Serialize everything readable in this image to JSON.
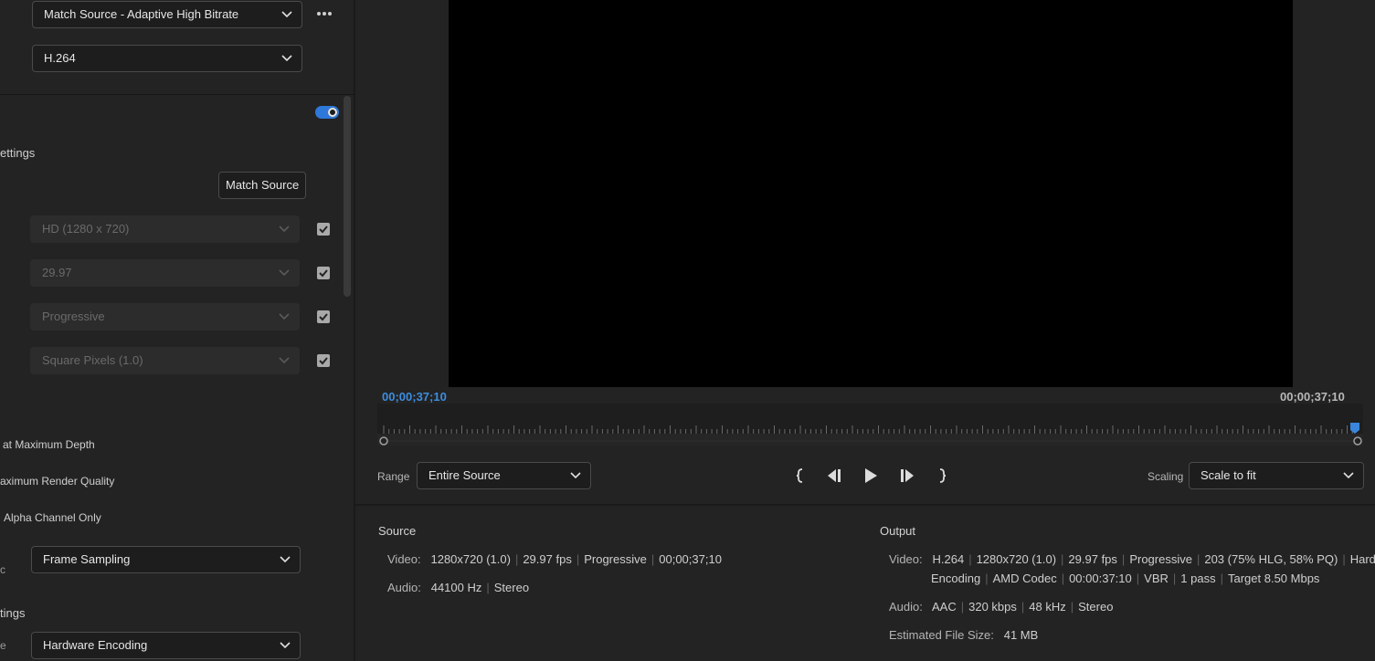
{
  "left": {
    "preset_select": "Match Source - Adaptive High Bitrate",
    "format_select": "H.264",
    "settings_label": "ettings",
    "match_source_button": "Match Source",
    "frame_size_select": "HD (1280 x 720)",
    "frame_rate_select": "29.97",
    "field_order_select": "Progressive",
    "aspect_select": "Square Pixels (1.0)",
    "max_depth_label": "at Maximum Depth",
    "max_render_label": "aximum Render Quality",
    "alpha_label": "Alpha Channel Only",
    "time_interp_label": "c",
    "time_interp_select": "Frame Sampling",
    "encoding_settings_label": "tings",
    "perf_label": "e",
    "performance_select": "Hardware Encoding"
  },
  "player": {
    "timecode_current": "00;00;37;10",
    "timecode_end": "00;00;37;10",
    "range_label": "Range",
    "range_select": "Entire Source",
    "scaling_label": "Scaling",
    "scaling_select": "Scale to fit"
  },
  "source": {
    "heading": "Source",
    "video_key": "Video:",
    "video_values": [
      "1280x720 (1.0)",
      "29.97 fps",
      "Progressive",
      "00;00;37;10"
    ],
    "audio_key": "Audio:",
    "audio_values": [
      "44100 Hz",
      "Stereo"
    ]
  },
  "output": {
    "heading": "Output",
    "video_key": "Video:",
    "video_line1": [
      "H.264",
      "1280x720 (1.0)",
      "29.97 fps",
      "Progressive",
      "203 (75% HLG, 58% PQ)",
      "Hardware"
    ],
    "video_line2": [
      "Encoding",
      "AMD Codec",
      "00:00:37:10",
      "VBR",
      "1 pass",
      "Target 8.50 Mbps"
    ],
    "audio_key": "Audio:",
    "audio_values": [
      "AAC",
      "320 kbps",
      "48 kHz",
      "Stereo"
    ],
    "size_key": "Estimated File Size:",
    "size_value": "41 MB"
  },
  "colors": {
    "accent": "#2d78d8",
    "timecode_blue": "#3d8de0",
    "bg": "#232323"
  },
  "icons": [
    "more-icon",
    "chevron-down-icon",
    "checkbox-checked-icon",
    "mark-in-icon",
    "step-back-icon",
    "play-icon",
    "step-forward-icon",
    "mark-out-icon",
    "playhead-icon"
  ]
}
